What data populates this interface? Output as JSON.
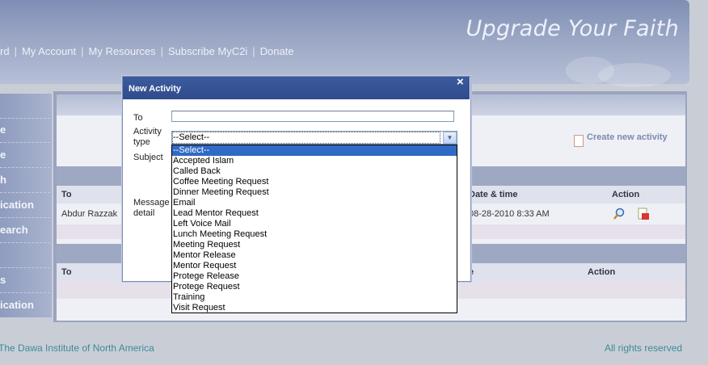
{
  "header": {
    "tagline": "Upgrade Your Faith",
    "nav": [
      "rd",
      "My Account",
      "My Resources",
      "Subscribe MyC2i",
      "Donate"
    ]
  },
  "sidebar": {
    "items": [
      "",
      "e",
      "h",
      "ication",
      "earch",
      "",
      "s",
      "ication"
    ]
  },
  "main": {
    "create_link": "Create new activity",
    "table1": {
      "headers": [
        "To",
        "Date & time",
        "Action"
      ],
      "rows": [
        {
          "to": "Abdur Razzak",
          "date": "08-28-2010 8:33 AM"
        }
      ]
    },
    "table2": {
      "headers": [
        "To",
        "e",
        "Action"
      ]
    }
  },
  "modal": {
    "title": "New Activity",
    "close_glyph": "×",
    "labels": {
      "to": "To",
      "activity_type_line1": "Activity",
      "activity_type_line2": "type",
      "subject": "Subject",
      "message_line1": "Message",
      "message_line2": "detail"
    },
    "to_value": "",
    "activity_type": {
      "selected": "--Select--",
      "options": [
        "--Select--",
        "Accepted Islam",
        "Called Back",
        "Coffee Meeting Request",
        "Dinner Meeting Request",
        "Email",
        "Lead Mentor Request",
        "Left Voice Mail",
        "Lunch Meeting Request",
        "Meeting Request",
        "Mentor Release",
        "Mentor Request",
        "Protege Release",
        "Protege Request",
        "Training",
        "Visit Request"
      ]
    }
  },
  "footer": {
    "left": "The Dawa Institute of North America",
    "right": "All rights reserved"
  },
  "colors": {
    "modal_title_bg": "#2f4b8c",
    "highlight": "#316ac5",
    "footer_text": "#3e8a98"
  }
}
